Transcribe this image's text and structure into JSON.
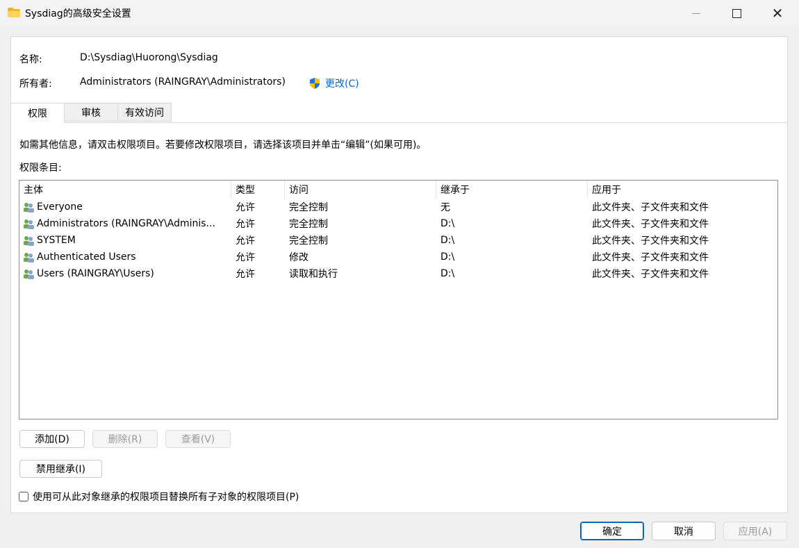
{
  "window": {
    "title": "Sysdiag的高级安全设置"
  },
  "info": {
    "name_label": "名称:",
    "name_value": "D:\\Sysdiag\\Huorong\\Sysdiag",
    "owner_label": "所有者:",
    "owner_value": "Administrators (RAINGRAY\\Administrators)",
    "change_link": "更改(C)"
  },
  "tabs": [
    {
      "label": "权限",
      "active": true
    },
    {
      "label": "审核",
      "active": false
    },
    {
      "label": "有效访问",
      "active": false
    }
  ],
  "permissions": {
    "instructions": "如需其他信息，请双击权限项目。若要修改权限项目，请选择该项目并单击“编辑”(如果可用)。",
    "entries_label": "权限条目:",
    "columns": [
      "主体",
      "类型",
      "访问",
      "继承于",
      "应用于"
    ],
    "rows": [
      {
        "principal": "Everyone",
        "type": "允许",
        "access": "完全控制",
        "inherited": "无",
        "applies": "此文件夹、子文件夹和文件"
      },
      {
        "principal": "Administrators (RAINGRAY\\Adminis...",
        "type": "允许",
        "access": "完全控制",
        "inherited": "D:\\",
        "applies": "此文件夹、子文件夹和文件"
      },
      {
        "principal": "SYSTEM",
        "type": "允许",
        "access": "完全控制",
        "inherited": "D:\\",
        "applies": "此文件夹、子文件夹和文件"
      },
      {
        "principal": "Authenticated Users",
        "type": "允许",
        "access": "修改",
        "inherited": "D:\\",
        "applies": "此文件夹、子文件夹和文件"
      },
      {
        "principal": "Users (RAINGRAY\\Users)",
        "type": "允许",
        "access": "读取和执行",
        "inherited": "D:\\",
        "applies": "此文件夹、子文件夹和文件"
      }
    ]
  },
  "buttons": {
    "add": "添加(D)",
    "remove": "删除(R)",
    "view": "查看(V)",
    "disable_inheritance": "禁用继承(I)",
    "ok": "确定",
    "cancel": "取消",
    "apply": "应用(A)"
  },
  "replace_checkbox": {
    "label": "使用可从此对象继承的权限项目替换所有子对象的权限项目(P)",
    "checked": false
  },
  "colors": {
    "accent": "#0067c0",
    "link": "#0066cc"
  }
}
